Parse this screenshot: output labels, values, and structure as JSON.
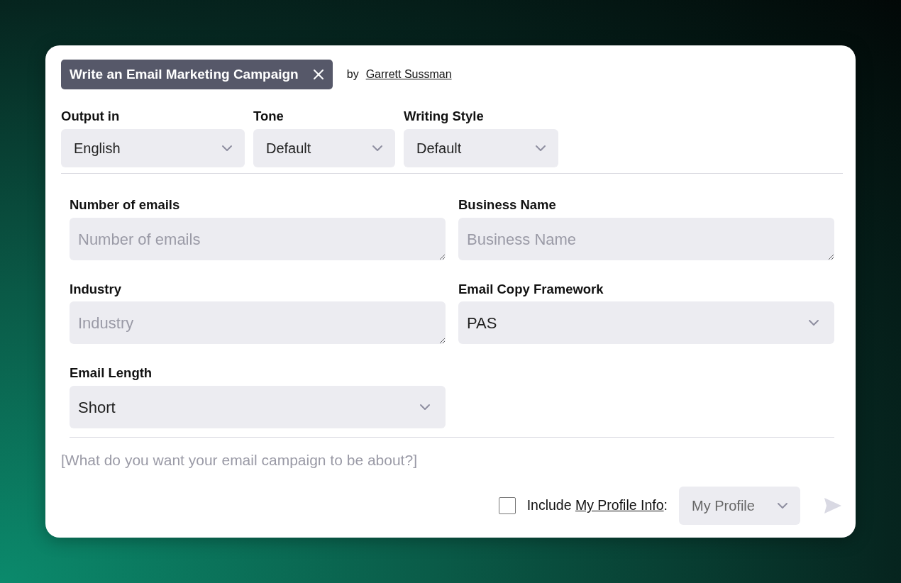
{
  "header": {
    "title": "Write an Email Marketing Campaign",
    "by_label": "by",
    "author": "Garrett Sussman"
  },
  "options": [
    {
      "label": "Output in",
      "value": "English"
    },
    {
      "label": "Tone",
      "value": "Default"
    },
    {
      "label": "Writing Style",
      "value": "Default"
    }
  ],
  "fields": [
    {
      "kind": "text",
      "label": "Number of emails",
      "placeholder": "Number of emails"
    },
    {
      "kind": "text",
      "label": "Business Name",
      "placeholder": "Business Name"
    },
    {
      "kind": "text",
      "label": "Industry",
      "placeholder": "Industry"
    },
    {
      "kind": "select",
      "label": "Email Copy Framework",
      "value": "PAS"
    },
    {
      "kind": "select",
      "label": "Email Length",
      "value": "Short"
    }
  ],
  "prompt": {
    "placeholder": "[What do you want your email campaign to be about?]"
  },
  "profile": {
    "checked": false,
    "text_before": "Include",
    "link": "My Profile Info",
    "text_after": ":",
    "select_value": "My Profile"
  }
}
